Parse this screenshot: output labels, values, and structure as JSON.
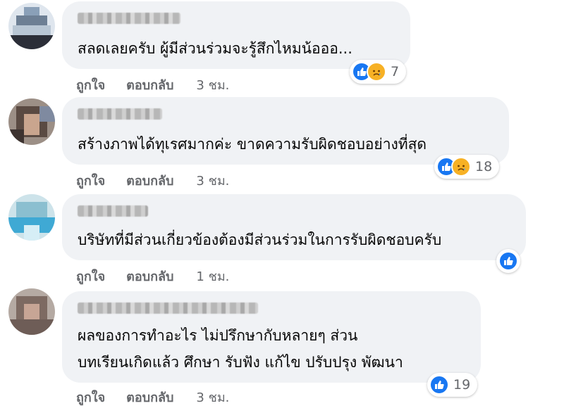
{
  "comments": [
    {
      "text_lines": [
        "สลดเลยครับ ผู้มีส่วนร่วมจะรู้สึกไหมน้อออ..."
      ],
      "reactions": [
        "like",
        "sad"
      ],
      "reaction_count": "7",
      "like_label": "ถูกใจ",
      "reply_label": "ตอบกลับ",
      "time": "3 ชม."
    },
    {
      "text_lines": [
        "สร้างภาพได้ทุเรศมากค่ะ ขาดความรับผิดชอบอย่างที่สุด"
      ],
      "reactions": [
        "like",
        "sad"
      ],
      "reaction_count": "18",
      "like_label": "ถูกใจ",
      "reply_label": "ตอบกลับ",
      "time": "3 ชม."
    },
    {
      "text_lines": [
        "บริษัทที่มีส่วนเกี่ยวข้องต้องมีส่วนร่วมในการรับผิดชอบครับ"
      ],
      "reactions": [
        "like"
      ],
      "reaction_count": "",
      "like_label": "ถูกใจ",
      "reply_label": "ตอบกลับ",
      "time": "1 ชม."
    },
    {
      "text_lines": [
        "ผลของการทำอะไร ไม่ปรึกษากับหลายๆ ส่วน",
        "บทเรียนเกิดแล้ว ศึกษา รับฟัง แก้ไข ปรับปรุง พัฒนา"
      ],
      "reactions": [
        "like"
      ],
      "reaction_count": "19",
      "like_label": "ถูกใจ",
      "reply_label": "ตอบกลับ",
      "time": "3 ชม."
    }
  ],
  "colors": {
    "bubble_bg": "#f0f2f5",
    "like_blue": "#1877f2",
    "sad_yellow": "#f7b125",
    "meta_gray": "#65676b"
  },
  "icons": [
    "thumbs-up-icon",
    "sad-face-icon"
  ]
}
